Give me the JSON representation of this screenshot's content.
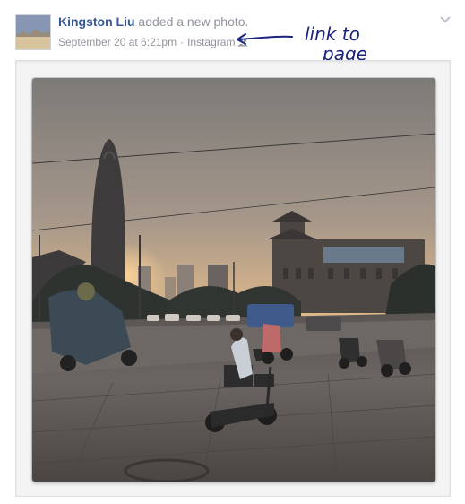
{
  "post": {
    "author": "Kingston Liu",
    "action": " added a new photo.",
    "timestamp": "September 20 at 6:21pm",
    "separator": "·",
    "source": "Instagram"
  },
  "annotation": {
    "line1": "link to",
    "line2": "page",
    "color": "#1a237e"
  },
  "icons": {
    "menu": "chevron-down-icon",
    "audience": "people-icon"
  },
  "colors": {
    "author_link": "#365899",
    "meta_text": "#90949c"
  }
}
